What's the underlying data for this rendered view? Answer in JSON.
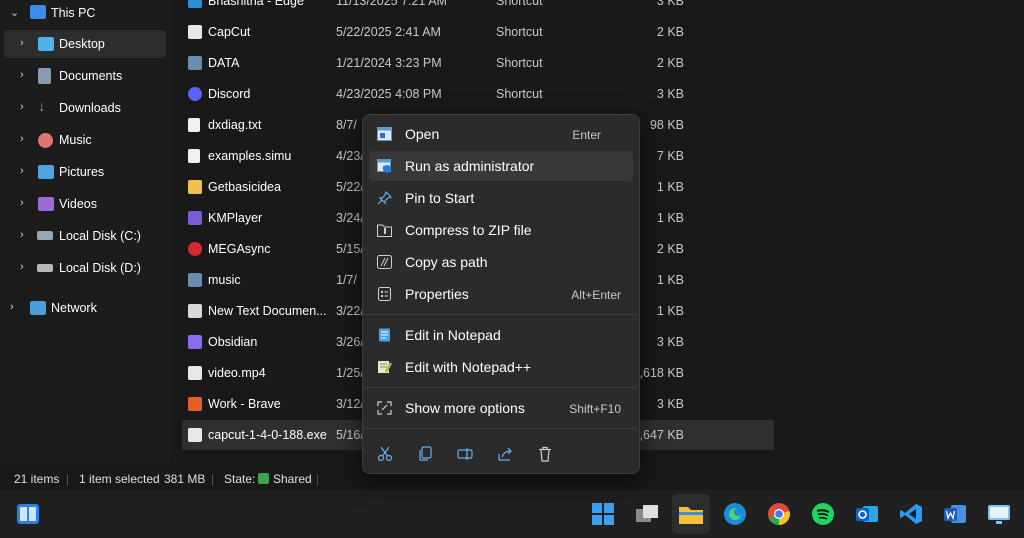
{
  "nav": {
    "items": [
      {
        "label": "This PC"
      },
      {
        "label": "Desktop"
      },
      {
        "label": "Documents"
      },
      {
        "label": "Downloads"
      },
      {
        "label": "Music"
      },
      {
        "label": "Pictures"
      },
      {
        "label": "Videos"
      },
      {
        "label": "Local Disk (C:)"
      },
      {
        "label": "Local Disk (D:)"
      },
      {
        "label": "Network"
      }
    ]
  },
  "files": [
    {
      "name": "Bhashitha - Edge",
      "date": "11/13/2025 7:21 AM",
      "type": "Shortcut",
      "size": "3 KB"
    },
    {
      "name": "CapCut",
      "date": "5/22/2025 2:41 AM",
      "type": "Shortcut",
      "size": "2 KB"
    },
    {
      "name": "DATA",
      "date": "1/21/2024 3:23 PM",
      "type": "Shortcut",
      "size": "2 KB"
    },
    {
      "name": "Discord",
      "date": "4/23/2025 4:08 PM",
      "type": "Shortcut",
      "size": "3 KB"
    },
    {
      "name": "dxdiag.txt",
      "date": "8/7/",
      "type": "",
      "size": "98 KB"
    },
    {
      "name": "examples.simu",
      "date": "4/23/",
      "type": "",
      "size": "7 KB"
    },
    {
      "name": "Getbasicidea",
      "date": "5/22/",
      "type": "",
      "size": "1 KB"
    },
    {
      "name": "KMPlayer",
      "date": "3/24/",
      "type": "",
      "size": "1 KB"
    },
    {
      "name": "MEGAsync",
      "date": "5/15/",
      "type": "",
      "size": "2 KB"
    },
    {
      "name": "music",
      "date": "1/7/",
      "type": "",
      "size": "1 KB"
    },
    {
      "name": "New Text Documen...",
      "date": "3/22/",
      "type": "",
      "size": "1 KB"
    },
    {
      "name": "Obsidian",
      "date": "3/26/",
      "type": "",
      "size": "3 KB"
    },
    {
      "name": "video.mp4",
      "date": "1/25/",
      "type": "",
      "size": "5,618 KB"
    },
    {
      "name": "Work - Brave",
      "date": "3/12/",
      "type": "",
      "size": "3 KB"
    },
    {
      "name": "capcut-1-4-0-188.exe",
      "date": "5/16/",
      "type": "",
      "size": "0,647 KB"
    }
  ],
  "status": {
    "items": "21 items",
    "selected": "1 item selected",
    "size": "381 MB",
    "state_label": "State:",
    "state_value": "Shared"
  },
  "context_menu": {
    "items": [
      {
        "label": "Open",
        "shortcut": "Enter"
      },
      {
        "label": "Run as administrator",
        "shortcut": ""
      },
      {
        "label": "Pin to Start",
        "shortcut": ""
      },
      {
        "label": "Compress to ZIP file",
        "shortcut": ""
      },
      {
        "label": "Copy as path",
        "shortcut": ""
      },
      {
        "label": "Properties",
        "shortcut": "Alt+Enter"
      },
      {
        "label": "Edit in Notepad",
        "shortcut": ""
      },
      {
        "label": "Edit with Notepad++",
        "shortcut": ""
      },
      {
        "label": "Show more options",
        "shortcut": "Shift+F10"
      }
    ],
    "actions": [
      "cut-icon",
      "copy-icon",
      "rename-icon",
      "share-icon",
      "delete-icon"
    ]
  },
  "taskbar": {
    "icons": [
      "widgets-icon",
      "start-icon",
      "task-view-icon",
      "file-explorer-icon",
      "edge-icon",
      "chrome-icon",
      "spotify-icon",
      "outlook-icon",
      "vscode-icon",
      "word-icon",
      "remote-desktop-icon"
    ]
  },
  "colors": {
    "accent": "#0078d4",
    "menu_bg": "#2b2b2b",
    "selected_row": "#2f2f2f"
  }
}
